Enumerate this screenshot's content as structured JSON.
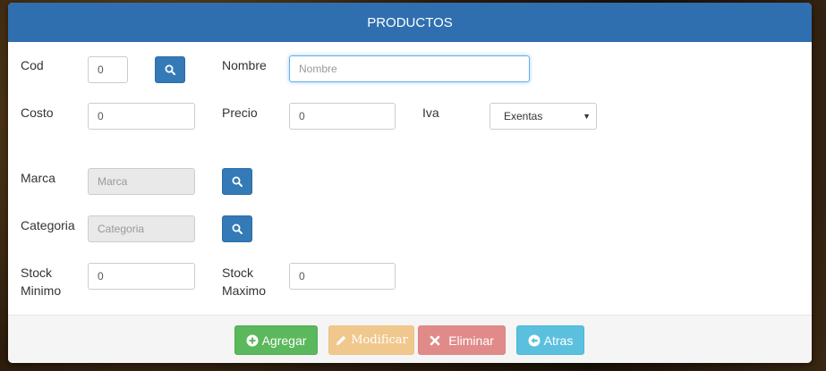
{
  "modal": {
    "title": "PRODUCTOS"
  },
  "form": {
    "cod": {
      "label": "Cod",
      "value": "0"
    },
    "nombre": {
      "label": "Nombre",
      "placeholder": "Nombre",
      "value": ""
    },
    "costo": {
      "label": "Costo",
      "value": "0"
    },
    "precio": {
      "label": "Precio",
      "value": "0"
    },
    "iva": {
      "label": "Iva",
      "selected": "Exentas"
    },
    "marca": {
      "label": "Marca",
      "placeholder": "Marca"
    },
    "categoria": {
      "label": "Categoria",
      "placeholder": "Categoria"
    },
    "stock_minimo": {
      "label_line1": "Stock",
      "label_line2": "Minimo",
      "value": "0"
    },
    "stock_maximo": {
      "label_line1": "Stock",
      "label_line2": "Maximo",
      "value": "0"
    }
  },
  "footer": {
    "agregar": "Agregar",
    "modificar": "Modificar",
    "eliminar": "Eliminar",
    "atras": "Atras"
  },
  "colors": {
    "header": "#2f6fb0",
    "primary": "#337ab7",
    "success": "#5cb85c",
    "warning_disabled": "#f0c88d",
    "danger_disabled": "#e08b89",
    "info": "#5bc0de"
  },
  "icons": {
    "search": "search-icon",
    "agregar": "plus-circle-icon",
    "modificar": "pencil-icon",
    "eliminar": "x-icon",
    "atras": "arrow-left-circle-icon"
  }
}
